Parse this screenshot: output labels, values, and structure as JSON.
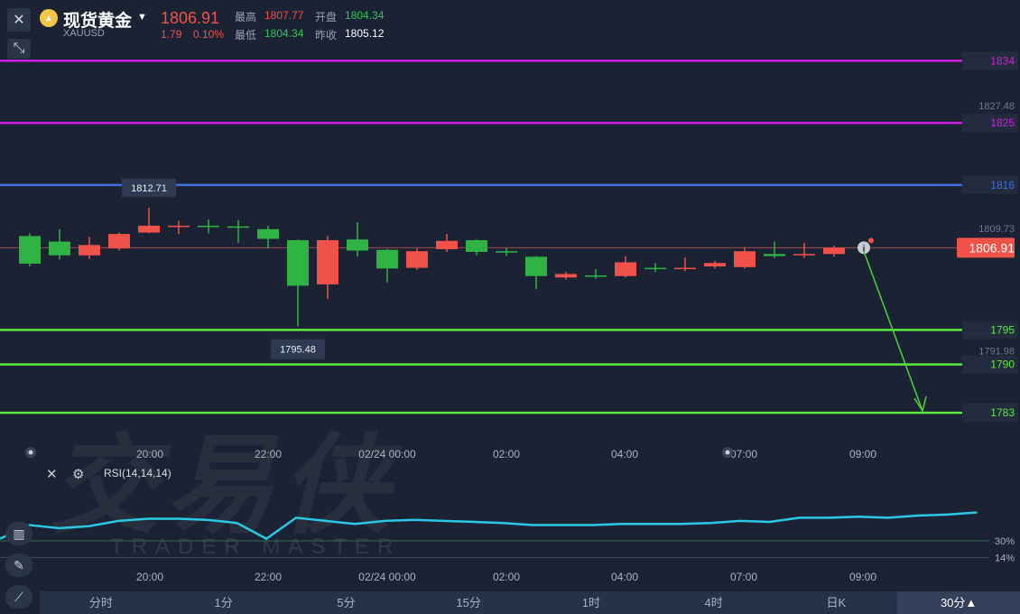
{
  "header": {
    "instrument_name": "现货黄金",
    "symbol": "XAUUSD",
    "price": "1806.91",
    "change": "1.79",
    "change_pct": "0.10%",
    "high_label": "最高",
    "high_value": "1807.77",
    "open_label": "开盘",
    "open_value": "1804.34",
    "low_label": "最低",
    "low_value": "1804.34",
    "prev_close_label": "昨收",
    "prev_close_value": "1805.12"
  },
  "watermark": {
    "main": "交易侠",
    "sub": "TRADER MASTER"
  },
  "colors": {
    "background": "#1a2233",
    "up": "#f0524a",
    "down": "#2fb344",
    "resistance_magenta": "#d21ee0",
    "pivot_blue": "#3f6fe0",
    "support_green": "#5ee840",
    "rsi_line": "#29c9e6"
  },
  "chart_data": {
    "type": "candlestick",
    "interval": "30分",
    "x_ticks": [
      "20:00",
      "22:00",
      "02/24 00:00",
      "02:00",
      "04:00",
      "07:00",
      "09:00"
    ],
    "y_ticks": [
      "1827.48",
      "1809.73",
      "1791.98"
    ],
    "ylim": [
      1780.0,
      1836.0
    ],
    "current_price": "1806.91",
    "high_marker": "1812.71",
    "low_marker": "1795.48",
    "horizontal_levels": [
      {
        "value": 1834,
        "label": "1834",
        "color": "#d21ee0"
      },
      {
        "value": 1825,
        "label": "1825",
        "color": "#d21ee0"
      },
      {
        "value": 1816,
        "label": "1816",
        "color": "#3f6fe0"
      },
      {
        "value": 1795,
        "label": "1795",
        "color": "#5ee840"
      },
      {
        "value": 1790,
        "label": "1790",
        "color": "#5ee840"
      },
      {
        "value": 1783,
        "label": "1783",
        "color": "#5ee840"
      }
    ],
    "projection_target": 1783,
    "candles": [
      {
        "open": 1808.6,
        "close": 1804.6,
        "high": 1809.0,
        "low": 1804.2
      },
      {
        "open": 1807.8,
        "close": 1805.8,
        "high": 1809.6,
        "low": 1805.2
      },
      {
        "open": 1805.8,
        "close": 1807.3,
        "high": 1808.5,
        "low": 1805.3
      },
      {
        "open": 1806.8,
        "close": 1808.9,
        "high": 1809.1,
        "low": 1806.5
      },
      {
        "open": 1809.1,
        "close": 1810.1,
        "high": 1812.71,
        "low": 1809.0
      },
      {
        "open": 1809.9,
        "close": 1810.1,
        "high": 1810.8,
        "low": 1808.9
      },
      {
        "open": 1810.1,
        "close": 1809.9,
        "high": 1811.0,
        "low": 1809.0
      },
      {
        "open": 1810.0,
        "close": 1809.8,
        "high": 1810.9,
        "low": 1807.6
      },
      {
        "open": 1809.6,
        "close": 1808.2,
        "high": 1810.1,
        "low": 1806.8
      },
      {
        "open": 1808.0,
        "close": 1801.4,
        "high": 1808.1,
        "low": 1795.48
      },
      {
        "open": 1801.6,
        "close": 1808.0,
        "high": 1808.6,
        "low": 1799.5
      },
      {
        "open": 1808.1,
        "close": 1806.5,
        "high": 1810.6,
        "low": 1805.6
      },
      {
        "open": 1806.6,
        "close": 1803.9,
        "high": 1806.7,
        "low": 1801.9
      },
      {
        "open": 1804.0,
        "close": 1806.4,
        "high": 1806.8,
        "low": 1803.7
      },
      {
        "open": 1806.7,
        "close": 1807.9,
        "high": 1808.9,
        "low": 1806.3
      },
      {
        "open": 1808.0,
        "close": 1806.3,
        "high": 1808.1,
        "low": 1805.8
      },
      {
        "open": 1806.4,
        "close": 1806.2,
        "high": 1806.9,
        "low": 1805.7
      },
      {
        "open": 1805.6,
        "close": 1802.8,
        "high": 1805.7,
        "low": 1800.9
      },
      {
        "open": 1802.6,
        "close": 1803.1,
        "high": 1803.4,
        "low": 1802.3
      },
      {
        "open": 1802.9,
        "close": 1802.7,
        "high": 1803.8,
        "low": 1802.4
      },
      {
        "open": 1802.8,
        "close": 1804.8,
        "high": 1805.7,
        "low": 1802.6
      },
      {
        "open": 1804.0,
        "close": 1803.8,
        "high": 1804.7,
        "low": 1803.4
      },
      {
        "open": 1803.9,
        "close": 1804.0,
        "high": 1805.5,
        "low": 1803.5
      },
      {
        "open": 1804.2,
        "close": 1804.7,
        "high": 1805.0,
        "low": 1803.9
      },
      {
        "open": 1804.1,
        "close": 1806.4,
        "high": 1807.0,
        "low": 1803.9
      },
      {
        "open": 1806.0,
        "close": 1805.7,
        "high": 1807.8,
        "low": 1805.4
      },
      {
        "open": 1805.9,
        "close": 1806.0,
        "high": 1807.6,
        "low": 1805.4
      },
      {
        "open": 1806.0,
        "close": 1806.91,
        "high": 1807.2,
        "low": 1805.6
      }
    ],
    "rsi": {
      "label": "RSI(14,14,14)",
      "levels": [
        "30%",
        "14%"
      ],
      "level_values": [
        30,
        14
      ],
      "ylim": [
        5,
        85
      ],
      "values": [
        32,
        45,
        42,
        44,
        49,
        51,
        51,
        50,
        47,
        32,
        52,
        49,
        46,
        49,
        50,
        49,
        48,
        47,
        45,
        45,
        45,
        46,
        46,
        46,
        47,
        49,
        48,
        52,
        52,
        53,
        52,
        54,
        55,
        57
      ]
    }
  },
  "bottom_tabs": [
    "分时",
    "1分",
    "5分",
    "15分",
    "1时",
    "4时",
    "日K",
    "30分▲"
  ],
  "icons": [
    "close-icon",
    "shrink-icon",
    "gold-coin-icon",
    "caret-down-icon",
    "info-icon",
    "crosshair-icon",
    "settings-icon",
    "indicator-icon",
    "pencil-icon",
    "line-tool-icon"
  ]
}
